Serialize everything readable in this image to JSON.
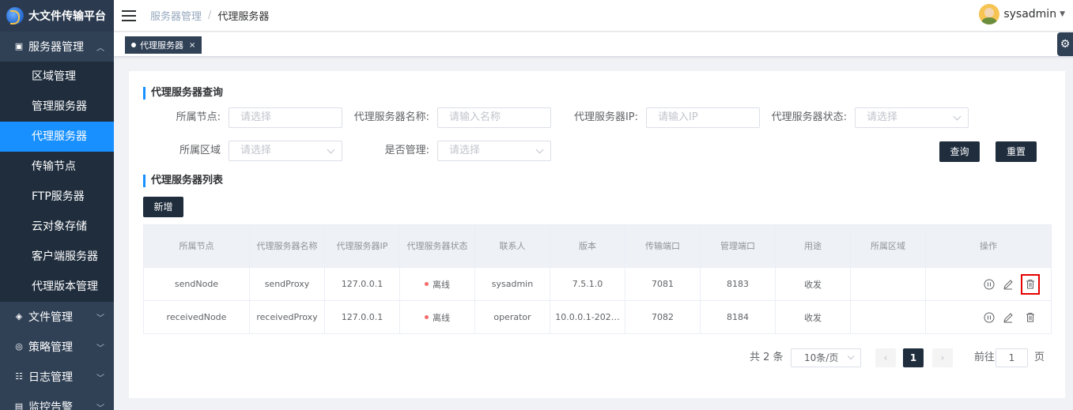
{
  "app": {
    "title": "大文件传输平台"
  },
  "sidebar": {
    "groups": [
      {
        "label": "服务器管理",
        "expanded": true,
        "icon": "cube-icon",
        "items": [
          {
            "label": "区域管理",
            "active": false
          },
          {
            "label": "管理服务器",
            "active": false
          },
          {
            "label": "代理服务器",
            "active": true
          },
          {
            "label": "传输节点",
            "active": false
          },
          {
            "label": "FTP服务器",
            "active": false
          },
          {
            "label": "云对象存储",
            "active": false
          },
          {
            "label": "客户端服务器",
            "active": false
          },
          {
            "label": "代理版本管理",
            "active": false
          }
        ]
      },
      {
        "label": "文件管理",
        "icon": "layers-icon"
      },
      {
        "label": "策略管理",
        "icon": "strategy-icon"
      },
      {
        "label": "日志管理",
        "icon": "log-icon"
      },
      {
        "label": "监控告警",
        "icon": "monitor-icon"
      }
    ]
  },
  "header": {
    "breadcrumb": [
      "服务器管理",
      "代理服务器"
    ],
    "user": "sysadmin"
  },
  "tags": [
    {
      "label": "代理服务器",
      "close": "×"
    }
  ],
  "query": {
    "title": "代理服务器查询",
    "fields": {
      "node": {
        "label": "所属节点:",
        "placeholder": "请选择"
      },
      "name": {
        "label": "代理服务器名称:",
        "placeholder": "请输入名称"
      },
      "ip": {
        "label": "代理服务器IP:",
        "placeholder": "请输入IP"
      },
      "status": {
        "label": "代理服务器状态:",
        "placeholder": "请选择"
      },
      "region": {
        "label": "所属区域",
        "placeholder": "请选择"
      },
      "managed": {
        "label": "是否管理:",
        "placeholder": "请选择"
      }
    },
    "search_label": "查询",
    "reset_label": "重置"
  },
  "list": {
    "title": "代理服务器列表",
    "add_label": "新增",
    "columns": [
      "所属节点",
      "代理服务器名称",
      "代理服务器IP",
      "代理服务器状态",
      "联系人",
      "版本",
      "传输端口",
      "管理端口",
      "用途",
      "所属区域",
      "操作"
    ],
    "rows": [
      {
        "node": "sendNode",
        "name": "sendProxy",
        "ip": "127.0.0.1",
        "status": "离线",
        "contact": "sysadmin",
        "version": "7.5.1.0",
        "transfer_port": "7081",
        "manage_port": "8183",
        "usage": "收发",
        "region": ""
      },
      {
        "node": "receivedNode",
        "name": "receivedProxy",
        "ip": "127.0.0.1",
        "status": "离线",
        "contact": "operator",
        "version": "10.0.0.1-202…",
        "transfer_port": "7082",
        "manage_port": "8184",
        "usage": "收发",
        "region": ""
      }
    ]
  },
  "pagination": {
    "total_text": "共 2 条",
    "page_size": "10条/页",
    "current_page": "1",
    "goto_label": "前往",
    "goto_value": "1",
    "page_suffix": "页",
    "prev": "‹",
    "next": "›"
  },
  "colors": {
    "sidebar_bg": "#304156",
    "active": "#1890ff",
    "dark_btn": "#1f2d3d",
    "offline": "#f56c6c",
    "highlight": "#e60000"
  }
}
